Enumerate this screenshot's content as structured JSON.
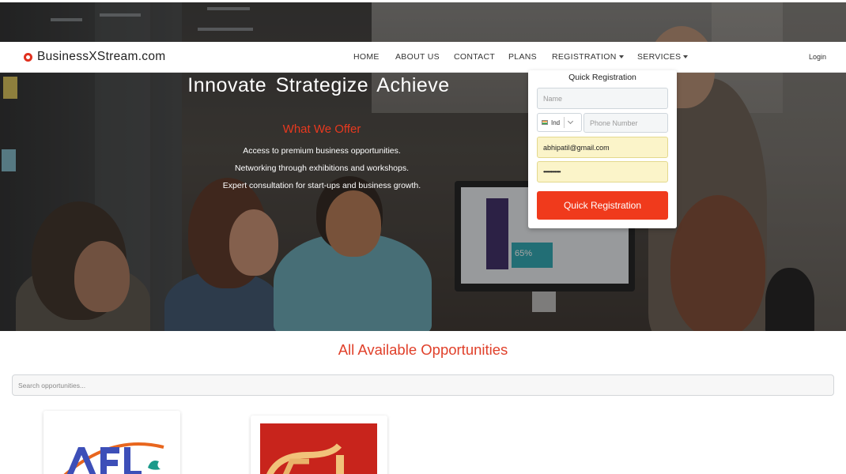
{
  "brand": {
    "name": "BusinessXStream.com"
  },
  "nav": {
    "items": [
      {
        "label": "HOME",
        "dropdown": false
      },
      {
        "label": "ABOUT US",
        "dropdown": false
      },
      {
        "label": "CONTACT",
        "dropdown": false
      },
      {
        "label": "PLANS",
        "dropdown": false
      },
      {
        "label": "REGISTRATION",
        "dropdown": true
      },
      {
        "label": "SERVICES",
        "dropdown": true
      }
    ],
    "login_label": "Login"
  },
  "hero": {
    "title": "Innovate Strategize Achieve",
    "offer_title": "What We Offer",
    "offer_items": [
      "Access to premium business opportunities.",
      "Networking through exhibitions and workshops.",
      "Expert consultation for start-ups and business growth."
    ],
    "screen_stat": "65%"
  },
  "quick_registration": {
    "title": "Quick Registration",
    "name_placeholder": "Name",
    "country_code": "Ind",
    "phone_placeholder": "Phone Number",
    "email_value": "abhipatil@gmail.com",
    "password_mask": "••••••••••••",
    "submit_label": "Quick Registration"
  },
  "opportunities": {
    "title": "All Available Opportunities",
    "search_placeholder": "Search opportunities..."
  },
  "colors": {
    "accent": "#f03a1c",
    "heading_red": "#e0402a",
    "autofill_yellow": "#fbf4c9"
  }
}
